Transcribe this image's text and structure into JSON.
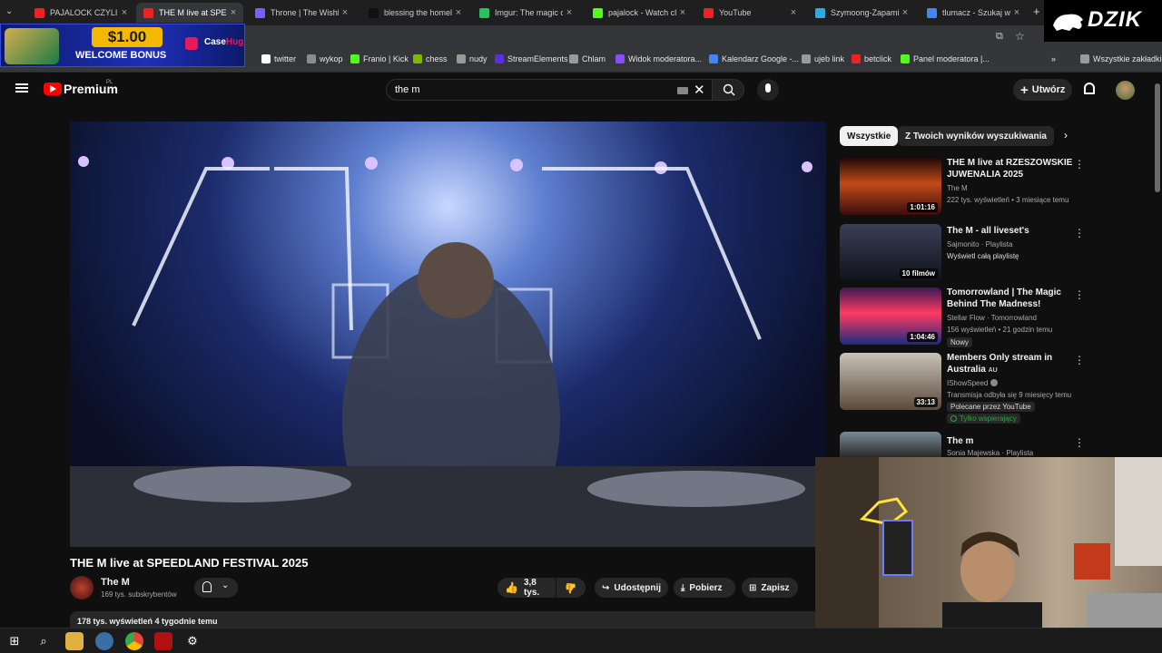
{
  "browser": {
    "tabs": [
      {
        "title": "PAJALOCK CZYLI PAJ...",
        "color": "#e22"
      },
      {
        "title": "THE M live at SPE",
        "color": "#e22",
        "active": true
      },
      {
        "title": "Throne | The Wishlist",
        "color": "#7b5cff"
      },
      {
        "title": "blessing the homeless",
        "color": "#111"
      },
      {
        "title": "Imgur: The magic of t",
        "color": "#2dbe60"
      },
      {
        "title": "pajalock - Watch clip",
        "color": "#53fc18"
      },
      {
        "title": "YouTube",
        "color": "#e22"
      },
      {
        "title": "Szymoong-Zapamiet",
        "color": "#3ad"
      },
      {
        "title": "tlumacz - Szukaj w G",
        "color": "#4285f4"
      }
    ],
    "bookmarks": [
      "twitter",
      "wykop",
      "Franio | Kick",
      "chess",
      "nudy",
      "StreamElements",
      "Chlam",
      "Widok moderatora...",
      "Kalendarz Google -...",
      "ujeb link",
      "betclick",
      "Panel moderatora |...",
      "Wszystkie zakładki"
    ]
  },
  "overlay": {
    "casino_amount": "$1.00",
    "casino_text": "WELCOME BONUS",
    "casino_brand": "Case",
    "casino_brand2": "Hug",
    "stream_logo": "DZIK"
  },
  "youtube": {
    "logo_text": "Premium",
    "logo_badge": "PL",
    "search_value": "the m",
    "create_label": "Utwórz",
    "video": {
      "title": "THE M live at SPEEDLAND FESTIVAL 2025",
      "channel": "The M",
      "subscribers": "169 tys. subskrybentów",
      "likes": "3,8 tys.",
      "share": "Udostępnij",
      "download": "Pobierz",
      "save": "Zapisz",
      "views_date": "178 tys. wyświetleń  4 tygodnie temu"
    },
    "chips": [
      "Wszystkie",
      "Z Twoich wyników wyszukiwania"
    ],
    "recs": [
      {
        "title": "THE M live at RZESZOWSKIE JUWENALIA 2025",
        "channel": "The M",
        "meta": "222 tys. wyświetleń • 3 miesiące temu",
        "duration": "1:01:16"
      },
      {
        "title": "The M - all liveset's",
        "channel": "Sajmonito · Playlista",
        "meta": "Wyświetl całą playlistę",
        "duration": "10 filmów"
      },
      {
        "title": "Tomorrowland | The Magic Behind The Madness!",
        "channel": "Stellar Flow · Tomorrowland",
        "meta": "156 wyświetleń • 21 godzin temu",
        "badge": "Nowy",
        "duration": "1:04:46"
      },
      {
        "title": "Members Only stream in Australia",
        "title_suffix": "AU",
        "channel": "IShowSpeed",
        "meta": "Transmisja odbyła się 9 miesięcy temu",
        "badge": "Polecane przez YouTube",
        "badge2": "Tylko wspierający",
        "duration": "33:13"
      },
      {
        "title": "The m",
        "channel": "Sonia Majewska · Playlista"
      }
    ]
  }
}
